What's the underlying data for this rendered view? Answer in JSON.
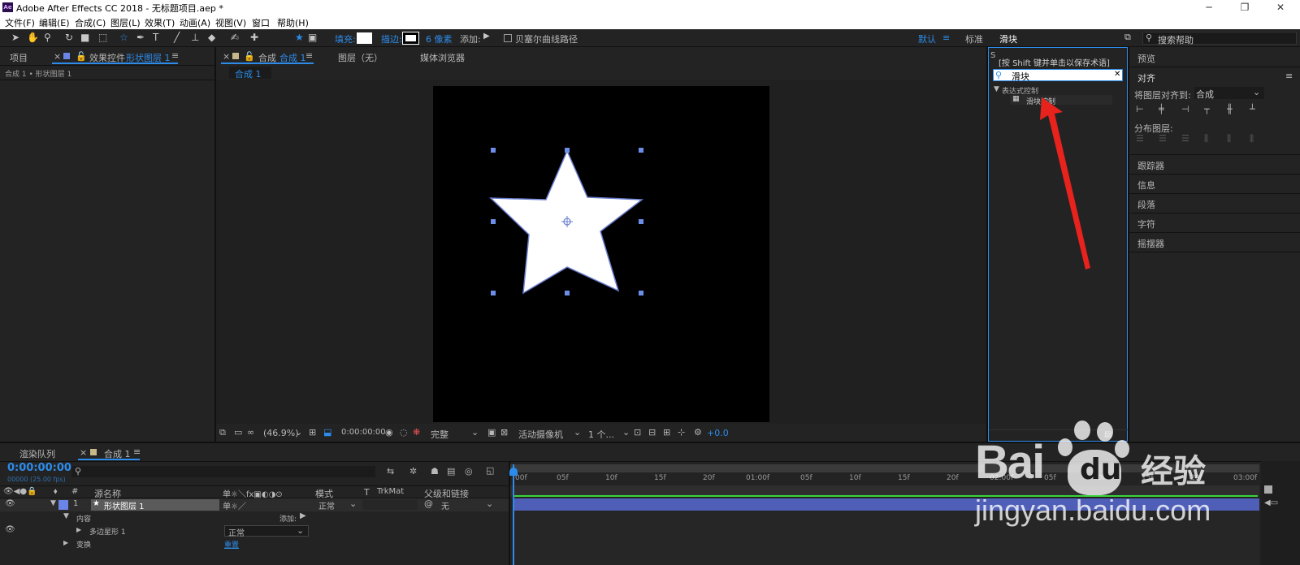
{
  "app": {
    "title": "Adobe After Effects CC 2018 - 无标题项目.aep *",
    "logo": "Ae"
  },
  "window": {
    "minimize": "─",
    "maximize": "❐",
    "close": "✕"
  },
  "menu": [
    "文件(F)",
    "编辑(E)",
    "合成(C)",
    "图层(L)",
    "效果(T)",
    "动画(A)",
    "视图(V)",
    "窗口",
    "帮助(H)"
  ],
  "toolbar": {
    "fill_label": "填充:",
    "stroke_label": "描边:",
    "stroke_width": "6 像素",
    "add_label": "添加:",
    "bezier_label": "贝塞尔曲线路径",
    "workspace_default": "默认",
    "workspace_standard": "标准",
    "workspace_search_text": "滑块",
    "search_help_placeholder": "搜索帮助"
  },
  "left_panel": {
    "tab_project": "项目",
    "tab_effects_prefix": "效果控件",
    "tab_effects_layer": "形状图层 1",
    "breadcrumb": "合成 1 • 形状图层 1"
  },
  "comp_panel": {
    "tab_comp_prefix": "合成",
    "tab_comp_name": "合成 1",
    "tab_layer": "图层（无）",
    "tab_media": "媒体浏览器",
    "subtab": "合成 1",
    "zoom": "(46.9%)",
    "timecode": "0:00:00:00",
    "resolution": "完整",
    "camera": "活动摄像机",
    "views": "1 个...",
    "exposure": "+0.0"
  },
  "effects_panel": {
    "hint": "[按 Shift 键并单击以保存术语]",
    "search_value": "滑块",
    "clear": "✕",
    "category": "表达式控制",
    "item": "滑块控制"
  },
  "right_panel": {
    "preview": "预览",
    "align": "对齐",
    "align_to_label": "将图层对齐到:",
    "align_to_value": "合成",
    "distribute": "分布图层:",
    "tracker": "跟踪器",
    "info": "信息",
    "paragraph": "段落",
    "character": "字符",
    "wiggler": "摇摆器"
  },
  "timeline": {
    "tab_render": "渲染队列",
    "tab_comp": "合成 1",
    "timecode": "0:00:00:00",
    "fps": "00000 (25.00 fps)",
    "col_source": "源名称",
    "col_mode": "模式",
    "col_t": "T",
    "col_trkmat": "TrkMat",
    "col_parent": "父级和链接",
    "layer_num": "1",
    "layer_name": "形状图层 1",
    "layer_mode": "正常",
    "layer_parent": "无",
    "contents_label": "内容",
    "add_label": "添加:",
    "polystar_label": "多边星形 1",
    "polystar_mode": "正常",
    "transform_label": "变换",
    "reset_label": "重置",
    "ruler_ticks": [
      "00f",
      "05f",
      "10f",
      "15f",
      "20f",
      "01:00f",
      "05f",
      "10f",
      "15f",
      "20f",
      "02:00f",
      "05f",
      "10f",
      "15f",
      "20f",
      "03:00f"
    ]
  },
  "watermark": {
    "brand": "Bai",
    "suffix": "经验",
    "url": "jingyan.baidu.com"
  },
  "colors": {
    "accent": "#2d8ceb",
    "layer_bar": "#4f5fb8",
    "handle": "#6b8fe8",
    "arrow": "#e8221c"
  }
}
